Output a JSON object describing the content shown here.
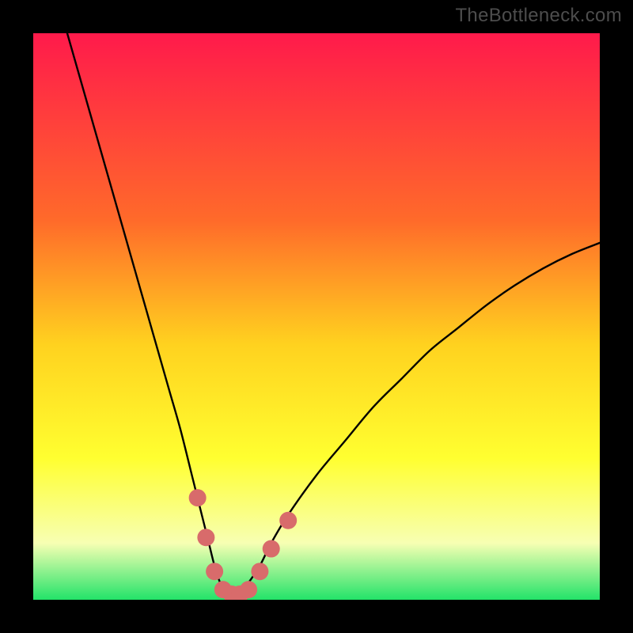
{
  "watermark": "TheBottleneck.com",
  "colors": {
    "frame": "#000000",
    "curve": "#000000",
    "marker": "#d86b6b",
    "grad_top": "#ff1a4b",
    "grad_mid1": "#ff6a2a",
    "grad_mid2": "#ffd21f",
    "grad_mid3": "#ffff30",
    "grad_low": "#f7ffb3",
    "grad_bot": "#23e369"
  },
  "chart_data": {
    "type": "line",
    "title": "",
    "xlabel": "",
    "ylabel": "",
    "xlim": [
      0,
      100
    ],
    "ylim": [
      0,
      100
    ],
    "series": [
      {
        "name": "bottleneck-curve",
        "x": [
          6,
          8,
          10,
          12,
          14,
          16,
          18,
          20,
          22,
          24,
          26,
          28,
          29,
          30,
          31,
          32,
          33,
          34,
          35,
          36,
          37,
          38,
          40,
          42,
          45,
          50,
          55,
          60,
          65,
          70,
          75,
          80,
          85,
          90,
          95,
          100
        ],
        "y": [
          100,
          93,
          86,
          79,
          72,
          65,
          58,
          51,
          44,
          37,
          30,
          22,
          18,
          14,
          10,
          6,
          3,
          1.5,
          1,
          1,
          1.5,
          3,
          6,
          10,
          15,
          22,
          28,
          34,
          39,
          44,
          48,
          52,
          55.5,
          58.5,
          61,
          63
        ]
      }
    ],
    "markers": {
      "name": "highlight-dots",
      "x": [
        29,
        30.5,
        32,
        33.5,
        35,
        36.5,
        38,
        40,
        42,
        45
      ],
      "y": [
        18,
        11,
        5,
        1.8,
        1,
        1,
        1.8,
        5,
        9,
        14
      ]
    }
  }
}
